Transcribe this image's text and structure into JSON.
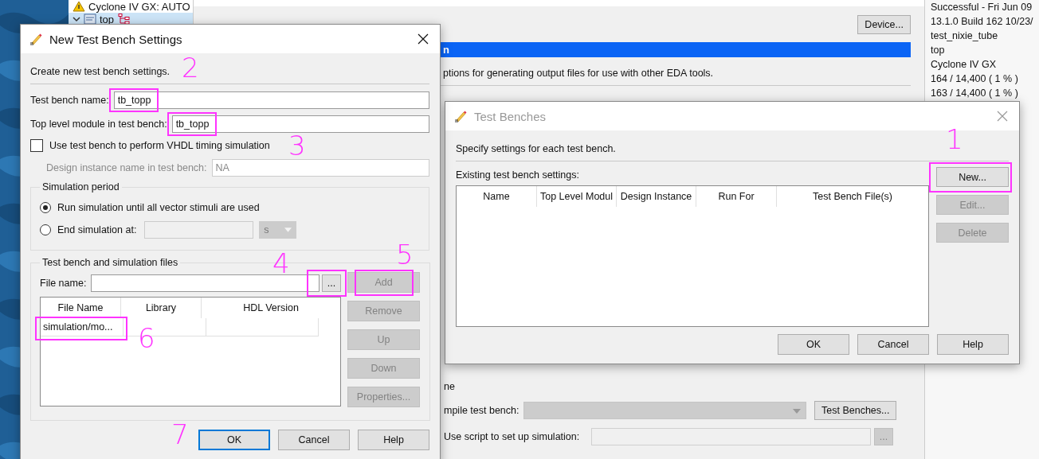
{
  "project_tree": [
    {
      "label": "Cyclone IV GX: AUTO",
      "kind": "device",
      "selected": false
    },
    {
      "label": "top",
      "kind": "entity",
      "selected": true,
      "expanded": true
    }
  ],
  "settings": {
    "device_button": "Device...",
    "header": "n",
    "description": "ptions for generating output files for use with other EDA tools.",
    "rows": [
      {
        "kind": "text",
        "label": "ne"
      },
      {
        "kind": "dropdown",
        "label": "mpile test bench:",
        "disabled": true,
        "button": "Test Benches..."
      },
      {
        "kind": "script",
        "label": "Use script to set up simulation:",
        "disabled": true,
        "button": "..."
      }
    ]
  },
  "summary": [
    "Successful - Fri Jun 09",
    "13.1.0 Build 162 10/23/",
    "test_nixie_tube",
    "top",
    "Cyclone IV GX",
    "164 / 14,400 ( 1 % )",
    "163 / 14,400 ( 1 % )"
  ],
  "tb_dialog": {
    "title": "Test Benches",
    "active": false,
    "intro": "Specify settings for each test bench.",
    "list_label": "Existing test bench settings:",
    "columns": [
      "Name",
      "Top Level Modul",
      "Design Instance",
      "Run For",
      "Test Bench File(s)"
    ],
    "side_buttons": [
      {
        "label": "New...",
        "disabled": false
      },
      {
        "label": "Edit...",
        "disabled": true
      },
      {
        "label": "Delete",
        "disabled": true
      }
    ],
    "buttons": [
      {
        "label": "OK",
        "default": false
      },
      {
        "label": "Cancel",
        "default": false
      },
      {
        "label": "Help",
        "default": false
      }
    ]
  },
  "new_dialog": {
    "title": "New Test Bench Settings",
    "active": true,
    "intro": "Create new test bench settings.",
    "name_label": "Test bench name:",
    "name_value": "tb_topp",
    "module_label": "Top level module in test bench:",
    "module_value": "tb_topp",
    "vhdl_checkbox": {
      "label": "Use test bench to perform VHDL timing simulation",
      "checked": false
    },
    "instance": {
      "label": "Design instance name in test bench:",
      "value": "NA",
      "disabled": true
    },
    "period": {
      "title": "Simulation period",
      "options": [
        {
          "label": "Run simulation until all vector stimuli are used",
          "selected": true
        },
        {
          "label": "End simulation at:",
          "selected": false
        }
      ],
      "unit": "s",
      "fields_disabled": true
    },
    "files": {
      "title": "Test bench and simulation files",
      "file_label": "File name:",
      "browse": "...",
      "buttons": [
        {
          "label": "Add",
          "disabled": true
        },
        {
          "label": "Remove",
          "disabled": true
        },
        {
          "label": "Up",
          "disabled": true
        },
        {
          "label": "Down",
          "disabled": true
        },
        {
          "label": "Properties...",
          "disabled": true
        }
      ],
      "columns": [
        "File Name",
        "Library",
        "HDL Version"
      ],
      "rows": [
        {
          "file_name": "simulation/mo..."
        }
      ]
    },
    "buttons": [
      {
        "label": "OK",
        "default": true
      },
      {
        "label": "Cancel",
        "default": false
      },
      {
        "label": "Help",
        "default": false
      }
    ]
  },
  "annotations": [
    "1",
    "2",
    "3",
    "4",
    "5",
    "6",
    "7"
  ]
}
